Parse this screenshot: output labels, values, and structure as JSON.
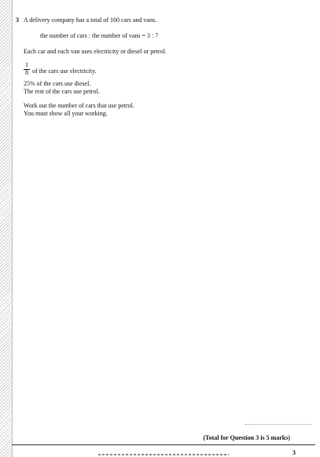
{
  "question": {
    "number": "3",
    "intro": "A delivery company has a total of 160 cars and vans.",
    "ratio": "the number of cars : the number of vans = 3 : 7",
    "fuel": "Each car and each van uses electricity or diesel or petrol.",
    "fraction": {
      "numerator": "1",
      "denominator": "8"
    },
    "electric": "of the cars use electricity.",
    "diesel": "25% of the cars use diesel.",
    "petrol": "The rest of the cars use petrol.",
    "task": "Work out the number of cars that use petrol.",
    "instruction": "You must show all your working."
  },
  "total": "(Total for Question 3 is 5 marks)",
  "page_number": "3"
}
